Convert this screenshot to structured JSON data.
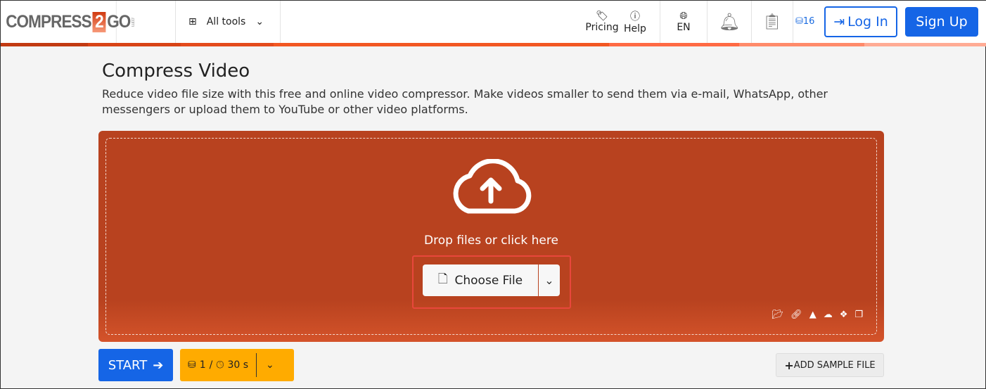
{
  "header": {
    "logo": "COMPRESS 2 GO .com",
    "logo_parts": [
      "COMPRESS",
      "2",
      "GO",
      ".com"
    ],
    "all_tools": "All tools",
    "pricing": "Pricing",
    "help": "Help",
    "language": "EN",
    "credits": "16",
    "login": "Log In",
    "signup": "Sign Up"
  },
  "main": {
    "title": "Compress Video",
    "description": "Reduce video file size with this free and online video compressor. Make videos smaller to send them via e-mail, WhatsApp, other messengers or upload them to YouTube or other video platforms.",
    "drop_text": "Drop files or click here",
    "choose_file": "Choose File",
    "start": "START",
    "cost_credits": "1",
    "cost_sep": "/",
    "cost_time": "30 s",
    "add_sample": "ADD SAMPLE FILE"
  },
  "colors": {
    "accent": "#1565e6",
    "drop": "#b8421f",
    "cost": "#ffab00"
  }
}
